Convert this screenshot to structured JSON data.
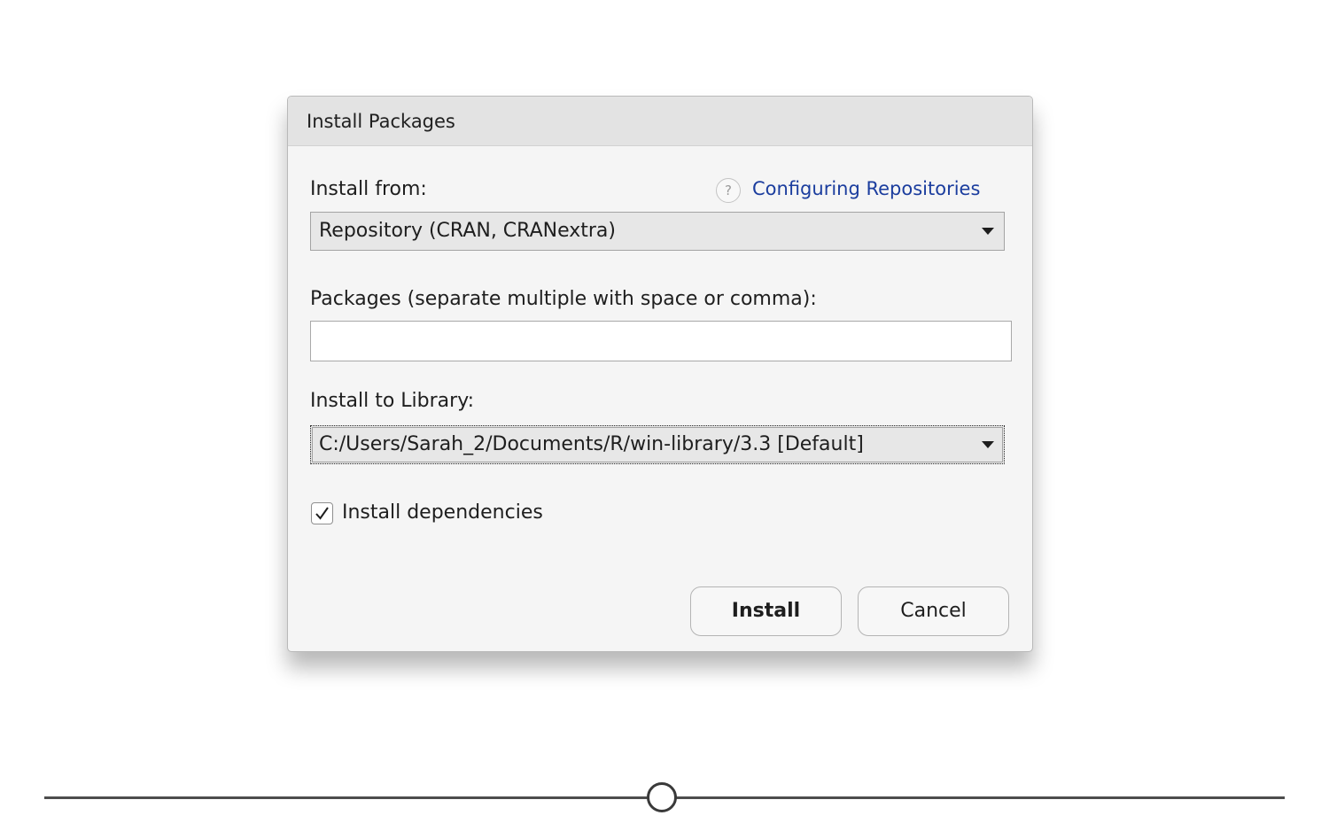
{
  "dialog": {
    "title": "Install Packages",
    "install_from": {
      "label": "Install from:",
      "help_icon": "question-circle-icon",
      "help_glyph": "?",
      "help_link": "Configuring Repositories",
      "selected": "Repository (CRAN, CRANextra)"
    },
    "packages": {
      "label": "Packages (separate multiple with space or comma):",
      "value": ""
    },
    "library": {
      "label": "Install to Library:",
      "selected": "C:/Users/Sarah_2/Documents/R/win-library/3.3 [Default]"
    },
    "dependencies": {
      "label": "Install dependencies",
      "checked": true
    },
    "buttons": {
      "install": "Install",
      "cancel": "Cancel"
    }
  },
  "colors": {
    "link": "#1b3d9e",
    "dialog_bg": "#f5f5f5",
    "titlebar_bg": "#e3e3e3"
  }
}
